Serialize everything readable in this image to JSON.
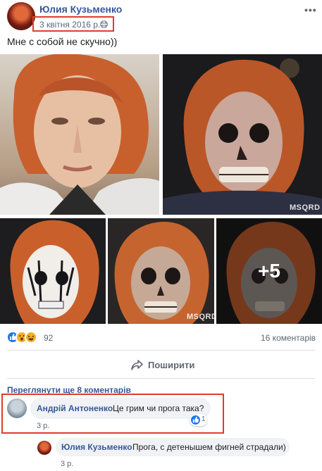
{
  "post": {
    "author": "Юлия Кузьменко",
    "date": "3 квітня 2016 р.",
    "privacy_icon": "globe-icon",
    "more_icon": "ellipsis-icon",
    "text": "Мне с собой не скучно))"
  },
  "photos": {
    "watermark": "MSQRD",
    "more_count": "+5"
  },
  "stats": {
    "reaction_icons": [
      "like-icon",
      "wow-icon",
      "haha-icon"
    ],
    "reaction_count": "92",
    "comment_count": "16 коментарів"
  },
  "actions": {
    "share_label": "Поширити",
    "share_icon": "share-arrow-icon"
  },
  "comments": {
    "view_more": "Переглянути ще 8 коментарів",
    "items": [
      {
        "author": "Андрій Антоненко",
        "text": "Це грим чи прога така?",
        "time": "3 р.",
        "likes": "1"
      },
      {
        "author": "Юлия Кузьменко",
        "text": "Прога, с детенышем фигней страдали)",
        "time": "3 р."
      }
    ]
  },
  "colors": {
    "link": "#385898",
    "highlight": "#e03c31",
    "like_blue": "#1877f2",
    "secondary_text": "#606770",
    "bubble": "#f0f2f5"
  }
}
